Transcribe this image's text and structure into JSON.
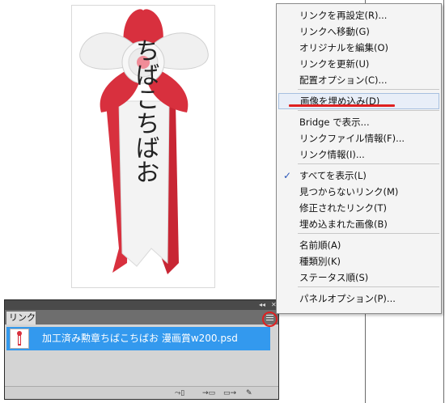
{
  "artwork": {
    "ribbon_text": "ちばこちばお"
  },
  "links_panel": {
    "tab_label": "リンク",
    "topbar_collapse": "◂◂",
    "topbar_close": "✕",
    "menu_button_icon": "panel-menu-icon",
    "links": [
      {
        "name": "加工済み勲章ちばこちばお 漫画賞w200.psd"
      }
    ],
    "footer_buttons": [
      "relink-icon",
      "goto-link-icon",
      "update-link-icon",
      "edit-original-icon"
    ]
  },
  "context_menu": {
    "groups": [
      [
        "リンクを再設定(R)...",
        "リンクへ移動(G)",
        "オリジナルを編集(O)",
        "リンクを更新(U)",
        "配置オプション(C)..."
      ],
      [
        "画像を埋め込み(D)"
      ],
      [
        "Bridge で表示...",
        "リンクファイル情報(F)...",
        "リンク情報(I)..."
      ],
      [
        "すべてを表示(L)",
        "見つからないリンク(M)",
        "修正されたリンク(T)",
        "埋め込まれた画像(B)"
      ],
      [
        "名前順(A)",
        "種類別(K)",
        "ステータス順(S)"
      ],
      [
        "パネルオプション(P)..."
      ]
    ],
    "highlighted_item": "画像を埋め込み(D)",
    "checked_item": "すべてを表示(L)"
  },
  "colors": {
    "selection_blue": "#3399ee",
    "annotation_red": "#e02020",
    "ribbon_red": "#d8303e"
  }
}
